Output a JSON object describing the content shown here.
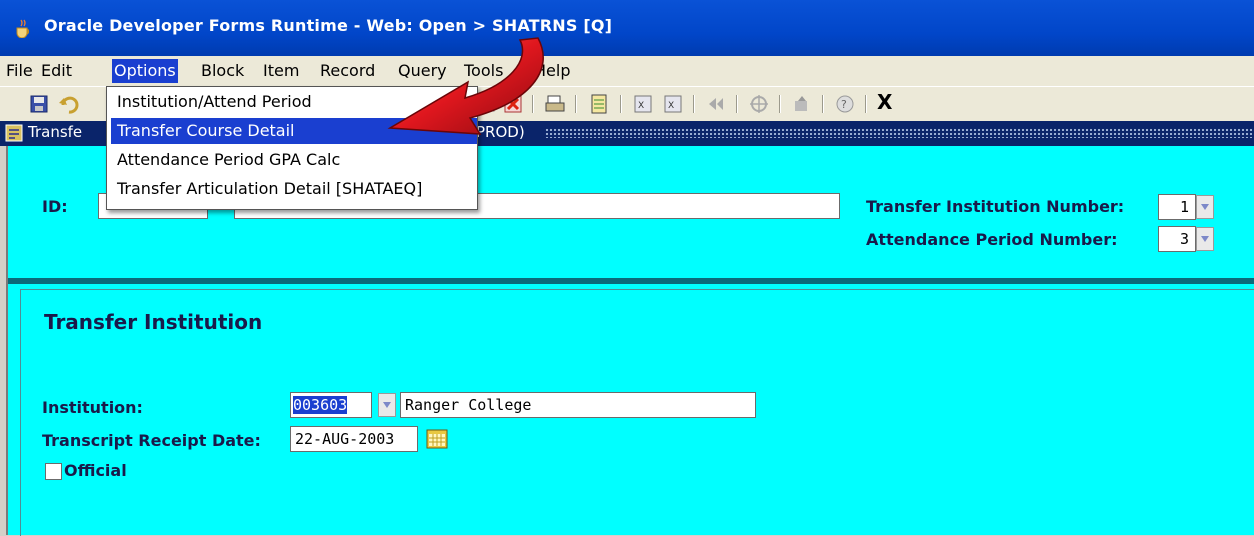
{
  "window": {
    "title": "Oracle Developer Forms Runtime - Web:  Open > SHATRNS [Q]"
  },
  "menubar": {
    "items": [
      {
        "label": "File"
      },
      {
        "label": "Edit"
      },
      {
        "label": "Options"
      },
      {
        "label": "Block"
      },
      {
        "label": "Item"
      },
      {
        "label": "Record"
      },
      {
        "label": "Query"
      },
      {
        "label": "Tools"
      },
      {
        "label": "Help"
      }
    ]
  },
  "options_menu": {
    "items": [
      {
        "label": "Institution/Attend Period"
      },
      {
        "label": "Transfer Course Detail"
      },
      {
        "label": "Attendance Period GPA Calc"
      },
      {
        "label": "Transfer Articulation Detail [SHATAEQ]"
      }
    ],
    "highlighted": "Transfer Course Detail"
  },
  "toolbar": {
    "exit_label": "X",
    "icons": [
      "save-icon",
      "rollback-icon",
      "delete-record-icon",
      "print-icon",
      "report-icon",
      "clear-field-icon",
      "clear-record-icon",
      "previous-icon",
      "target-icon",
      "forward-icon",
      "help-icon"
    ]
  },
  "form_title": {
    "title": "Transfe",
    "prod": "PROD)"
  },
  "key_block": {
    "id_label": "ID:",
    "id_value": "",
    "name_value": "",
    "transfer_inst_number_label": "Transfer Institution Number:",
    "transfer_inst_number_value": "1",
    "attend_period_number_label": "Attendance Period Number:",
    "attend_period_number_value": "3"
  },
  "transfer_institution": {
    "heading": "Transfer Institution",
    "institution_label": "Institution:",
    "institution_code": "003603",
    "institution_name": "Ranger College",
    "receipt_date_label": "Transcript Receipt Date:",
    "receipt_date_value": "22-AUG-2003",
    "official_label": "Official",
    "official_checked": false
  },
  "colors": {
    "canvas": "#00ffff",
    "titlebar": "#0146c9",
    "highlight": "#1a3fd0",
    "arrow": "#e0171e"
  }
}
